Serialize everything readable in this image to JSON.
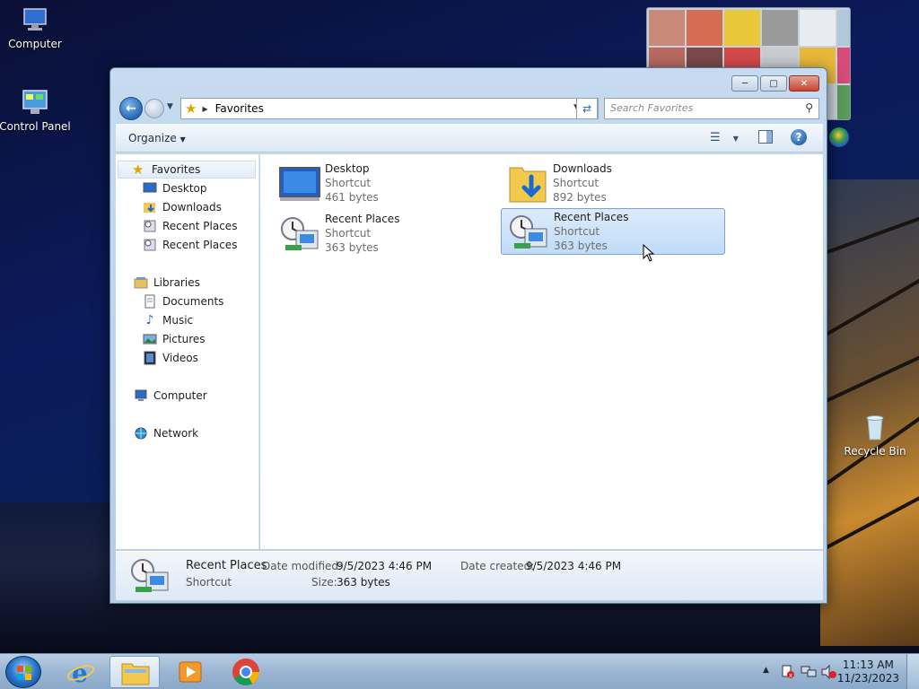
{
  "desktop": {
    "icons": [
      {
        "label": "Computer",
        "icon": "computer-icon"
      },
      {
        "label": "Control Panel",
        "icon": "control-panel-icon"
      },
      {
        "label": "Recycle Bin",
        "icon": "recycle-bin-icon"
      }
    ]
  },
  "window": {
    "address": {
      "location": "Favorites"
    },
    "search": {
      "placeholder": "Search Favorites"
    },
    "toolbar": {
      "organize_label": "Organize"
    },
    "nav": {
      "favorites": {
        "label": "Favorites",
        "items": [
          "Desktop",
          "Downloads",
          "Recent Places",
          "Recent Places"
        ]
      },
      "libraries": {
        "label": "Libraries",
        "items": [
          "Documents",
          "Music",
          "Pictures",
          "Videos"
        ]
      },
      "computer": "Computer",
      "network": "Network"
    },
    "files": [
      {
        "name": "Desktop",
        "type": "Shortcut",
        "size": "461 bytes",
        "icon": "desktop-shortcut-icon"
      },
      {
        "name": "Downloads",
        "type": "Shortcut",
        "size": "892 bytes",
        "icon": "downloads-folder-icon"
      },
      {
        "name": "Recent Places",
        "type": "Shortcut",
        "size": "363 bytes",
        "icon": "recent-places-icon"
      },
      {
        "name": "Recent Places",
        "type": "Shortcut",
        "size": "363 bytes",
        "icon": "recent-places-icon",
        "selected": true
      }
    ],
    "details": {
      "name": "Recent Places",
      "type": "Shortcut",
      "date_modified_label": "Date modified:",
      "date_modified": "9/5/2023 4:46 PM",
      "date_created_label": "Date created:",
      "date_created": "9/5/2023 4:46 PM",
      "size_label": "Size:",
      "size": "363 bytes"
    }
  },
  "taskbar": {
    "clock_time": "11:13 AM",
    "clock_date": "11/23/2023",
    "pinned": [
      "internet-explorer-icon",
      "windows-explorer-icon",
      "media-player-icon",
      "chrome-icon"
    ]
  },
  "colors": {
    "selection": "#c1dcf8",
    "selection_border": "#7da2ce",
    "window_frame": "#b5cde5",
    "close_button": "#c4452e"
  }
}
